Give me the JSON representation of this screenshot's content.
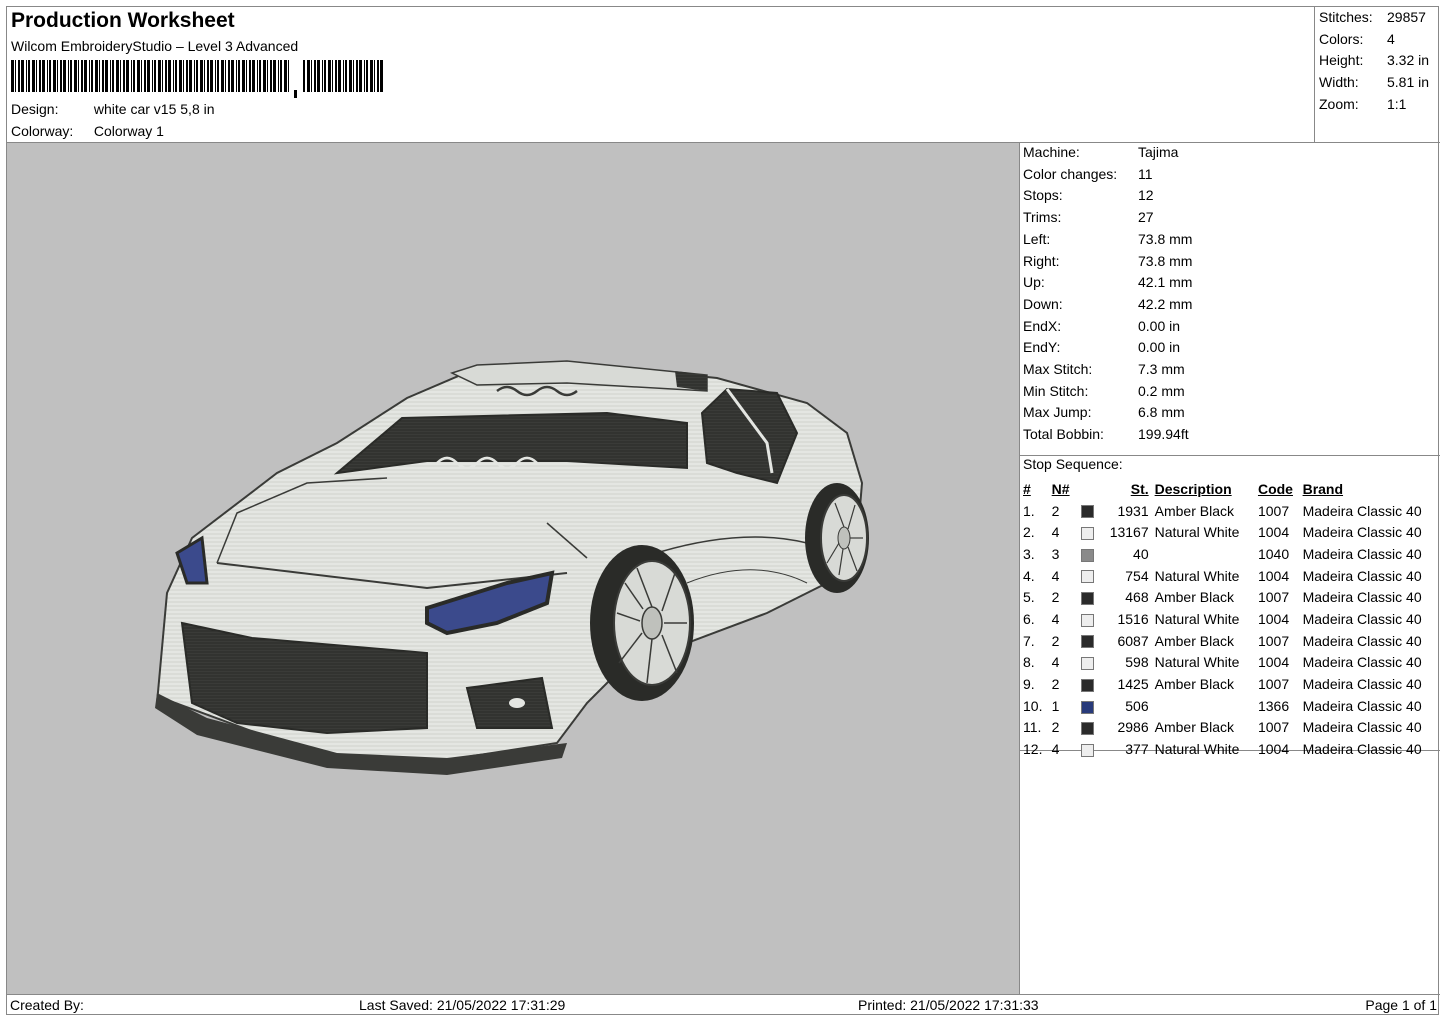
{
  "header": {
    "title": "Production Worksheet",
    "software": "Wilcom EmbroideryStudio – Level 3 Advanced",
    "design_label": "Design:",
    "design_value": "white car v15 5,8 in",
    "colorway_label": "Colorway:",
    "colorway_value": "Colorway 1"
  },
  "summary": [
    {
      "k": "Stitches:",
      "v": "29857"
    },
    {
      "k": "Colors:",
      "v": "4"
    },
    {
      "k": "Height:",
      "v": "3.32 in"
    },
    {
      "k": "Width:",
      "v": "5.81 in"
    },
    {
      "k": "Zoom:",
      "v": "1:1"
    }
  ],
  "machine": [
    {
      "k": "Machine:",
      "v": "Tajima"
    },
    {
      "k": "Color changes:",
      "v": "11"
    },
    {
      "k": "Stops:",
      "v": "12"
    },
    {
      "k": "Trims:",
      "v": "27"
    },
    {
      "k": "Left:",
      "v": "73.8 mm"
    },
    {
      "k": "Right:",
      "v": "73.8 mm"
    },
    {
      "k": "Up:",
      "v": "42.1 mm"
    },
    {
      "k": "Down:",
      "v": "42.2 mm"
    },
    {
      "k": "EndX:",
      "v": "0.00 in"
    },
    {
      "k": "EndY:",
      "v": "0.00 in"
    },
    {
      "k": "Max Stitch:",
      "v": "7.3 mm"
    },
    {
      "k": "Min Stitch:",
      "v": "0.2 mm"
    },
    {
      "k": "Max Jump:",
      "v": "6.8 mm"
    },
    {
      "k": "Total Bobbin:",
      "v": "199.94ft"
    }
  ],
  "stop_sequence": {
    "label": "Stop Sequence:",
    "headers": [
      "#",
      "N#",
      "St.",
      "Description",
      "Code",
      "Brand"
    ],
    "rows": [
      {
        "num": "1.",
        "n": "2",
        "color": "#2a2a2a",
        "st": "1931",
        "desc": "Amber Black",
        "code": "1007",
        "brand": "Madeira Classic 40"
      },
      {
        "num": "2.",
        "n": "4",
        "color": "#eeeeee",
        "st": "13167",
        "desc": "Natural White",
        "code": "1004",
        "brand": "Madeira Classic 40"
      },
      {
        "num": "3.",
        "n": "3",
        "color": "#8a8a8a",
        "st": "40",
        "desc": "",
        "code": "1040",
        "brand": "Madeira Classic 40"
      },
      {
        "num": "4.",
        "n": "4",
        "color": "#eeeeee",
        "st": "754",
        "desc": "Natural White",
        "code": "1004",
        "brand": "Madeira Classic 40"
      },
      {
        "num": "5.",
        "n": "2",
        "color": "#2a2a2a",
        "st": "468",
        "desc": "Amber Black",
        "code": "1007",
        "brand": "Madeira Classic 40"
      },
      {
        "num": "6.",
        "n": "4",
        "color": "#eeeeee",
        "st": "1516",
        "desc": "Natural White",
        "code": "1004",
        "brand": "Madeira Classic 40"
      },
      {
        "num": "7.",
        "n": "2",
        "color": "#2a2a2a",
        "st": "6087",
        "desc": "Amber Black",
        "code": "1007",
        "brand": "Madeira Classic 40"
      },
      {
        "num": "8.",
        "n": "4",
        "color": "#eeeeee",
        "st": "598",
        "desc": "Natural White",
        "code": "1004",
        "brand": "Madeira Classic 40"
      },
      {
        "num": "9.",
        "n": "2",
        "color": "#2a2a2a",
        "st": "1425",
        "desc": "Amber Black",
        "code": "1007",
        "brand": "Madeira Classic 40"
      },
      {
        "num": "10.",
        "n": "1",
        "color": "#283a7a",
        "st": "506",
        "desc": "",
        "code": "1366",
        "brand": "Madeira Classic 40"
      },
      {
        "num": "11.",
        "n": "2",
        "color": "#2a2a2a",
        "st": "2986",
        "desc": "Amber Black",
        "code": "1007",
        "brand": "Madeira Classic 40"
      },
      {
        "num": "12.",
        "n": "4",
        "color": "#eeeeee",
        "st": "377",
        "desc": "Natural White",
        "code": "1004",
        "brand": "Madeira Classic 40"
      }
    ]
  },
  "footer": {
    "created_by": "Created By:",
    "last_saved": "Last Saved: 21/05/2022 17:31:29",
    "printed": "Printed: 21/05/2022 17:31:33",
    "page": "Page 1 of 1"
  },
  "colors": {
    "preview_bg": "#c0c0c0",
    "car_body": "#e4e6e2",
    "car_dark": "#3a3b38",
    "headlight_blue": "#3b4a8c"
  }
}
